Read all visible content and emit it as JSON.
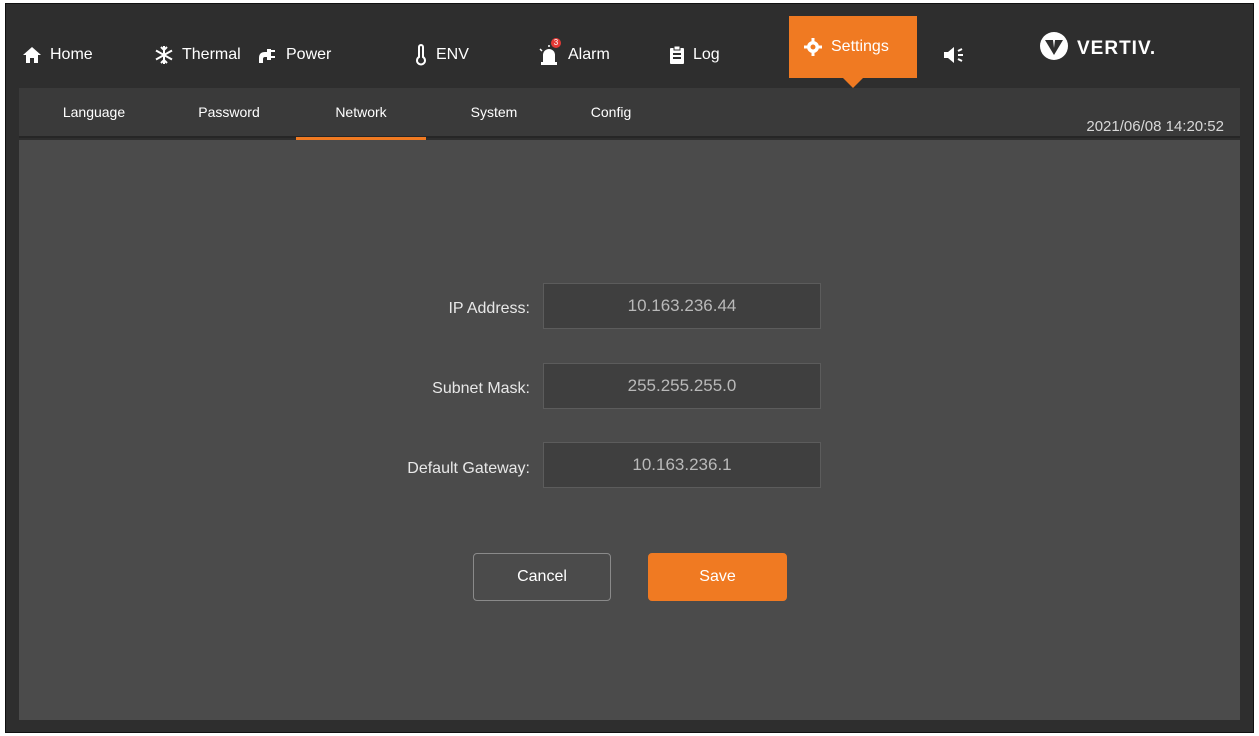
{
  "nav": {
    "home": "Home",
    "thermal": "Thermal",
    "power": "Power",
    "env": "ENV",
    "alarm": "Alarm",
    "alarm_badge": "3",
    "log": "Log",
    "settings": "Settings",
    "brand": "VERTIV."
  },
  "subnav": {
    "language": "Language",
    "password": "Password",
    "network": "Network",
    "system": "System",
    "config": "Config",
    "datetime": "2021/06/08 14:20:52"
  },
  "network": {
    "ip_label": "IP Address:",
    "ip_value": "10.163.236.44",
    "subnet_label": "Subnet Mask:",
    "subnet_value": "255.255.255.0",
    "gateway_label": "Default Gateway:",
    "gateway_value": "10.163.236.1"
  },
  "buttons": {
    "cancel": "Cancel",
    "save": "Save"
  },
  "colors": {
    "accent": "#f07a22",
    "alarm_badge": "#e53935",
    "background": "#4b4b4b"
  },
  "icons": [
    "home-icon",
    "snowflake-icon",
    "power-plug-icon",
    "thermometer-icon",
    "alarm-siren-icon",
    "clipboard-icon",
    "gear-icon",
    "speaker-icon",
    "vertiv-logo-icon"
  ]
}
